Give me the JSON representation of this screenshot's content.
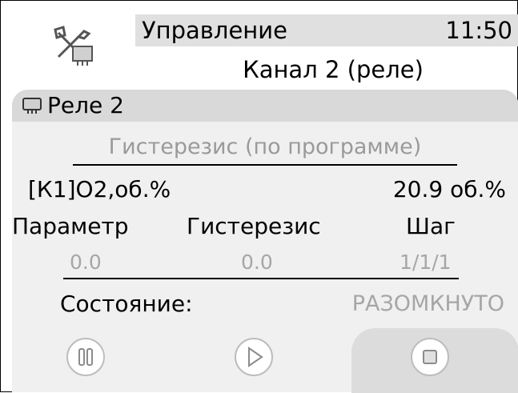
{
  "header": {
    "title": "Управление",
    "time": "11:50",
    "subtitle": "Канал 2 (реле)"
  },
  "section": {
    "title": "Реле 2",
    "icon": "relay-icon"
  },
  "hysteresis": {
    "title": "Гистерезис (по программе)",
    "param_name": "[К1]O2,об.%",
    "param_value": "20.9 об.%"
  },
  "columns": {
    "col1": "Параметр",
    "col2": "Гистерезис",
    "col3": "Шаг"
  },
  "values": {
    "v1": "0.0",
    "v2": "0.0",
    "v3": "1/1/1"
  },
  "state": {
    "label": "Состояние:",
    "value": "РАЗОМКНУТО"
  },
  "controls": {
    "pause_icon": "pause-icon",
    "play_icon": "play-icon",
    "stop_icon": "stop-icon"
  },
  "colors": {
    "accent_gray": "#d9d9d9",
    "disabled_text": "#a6a6a6"
  }
}
